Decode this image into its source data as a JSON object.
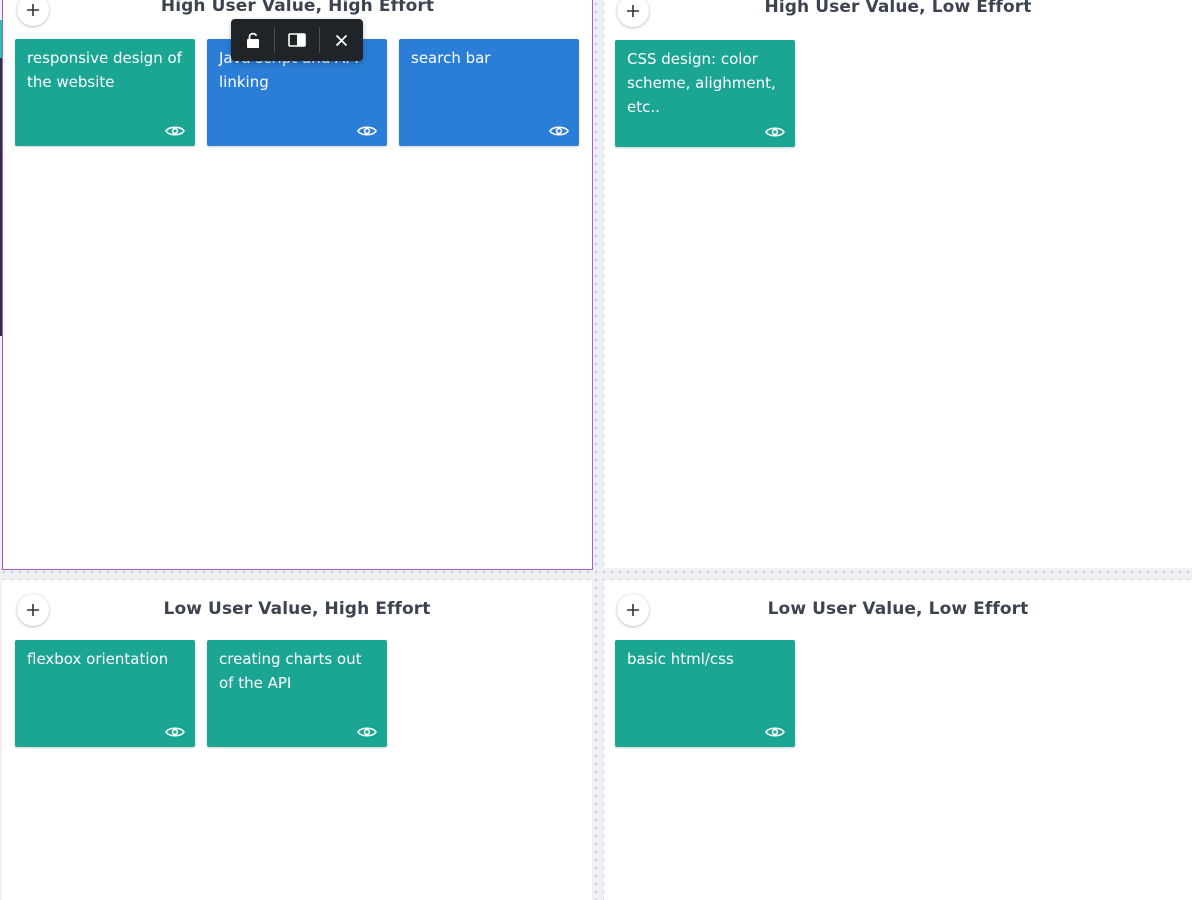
{
  "quadrants": {
    "top_left": {
      "title": "High User Value, High Effort",
      "cards": [
        {
          "text": "responsive design of the website",
          "color": "#1ba593"
        },
        {
          "text": "Java script and API linking",
          "color": "#2a7ed8"
        },
        {
          "text": "search bar",
          "color": "#2a7ed8"
        }
      ]
    },
    "top_right": {
      "title": "High User Value, Low Effort",
      "cards": [
        {
          "text": "CSS design: color scheme, alighment, etc..",
          "color": "#1ba593"
        }
      ]
    },
    "bottom_left": {
      "title": "Low User Value, High Effort",
      "cards": [
        {
          "text": "flexbox orientation",
          "color": "#1ba593"
        },
        {
          "text": "creating charts out of the API",
          "color": "#1ba593"
        }
      ]
    },
    "bottom_right": {
      "title": "Low User Value, Low Effort",
      "cards": [
        {
          "text": "basic html/css",
          "color": "#1ba593"
        }
      ]
    }
  },
  "toolbar": {
    "icons": [
      "lock-icon",
      "panel-toggle-icon",
      "close-icon"
    ]
  },
  "colors": {
    "teal": "#1ba593",
    "blue": "#2a7ed8",
    "selection": "#a855d8",
    "toolbar": "#1f2429"
  }
}
